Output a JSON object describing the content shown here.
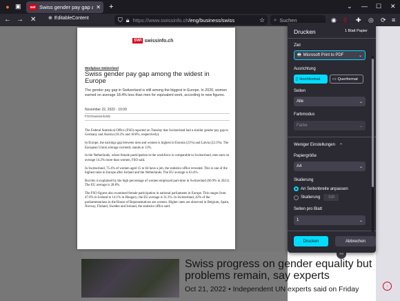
{
  "browser": {
    "tab_title": "Swiss gender pay gap among t",
    "favicon_text": "swi",
    "url_host": "https://www.swissinfo.ch",
    "url_path": "/eng/business/swiss",
    "search_placeholder": "Suchen",
    "editable_label": "EditableContent"
  },
  "preview": {
    "logo_mark": "SWI",
    "logo_site": "swissinfo.ch",
    "kicker": "Workplace Switzerland",
    "title": "Swiss gender pay gap among the widest in Europe",
    "lead": "The gender pay gap in Switzerland is still among the biggest in Europe. In 2020, women earned on average 18.4% less than men for equivalent work, according to new figures.",
    "date": "November 22, 2022 - 10:09",
    "credit": "FSO/swissinfo/sb",
    "paragraphs": [
      "The Federal Statistical Office (FSO) reported on Tuesday that Switzerland had a similar gender pay gap to Germany and Austria (18.3% and 18.8%, respectively).",
      "In Europe, the earnings gap between men and women is highest in Estonia (21%) and Latvia (22.3%). The European Union average currently stands at 13%.",
      "In the Netherlands, where female participation in the workforce is comparable to Switzerland, men earn on average 14.2% more than women, FSO said.",
      "In Switzerland, 75.4% of women aged 15 to 64 have a job, the statistics office revealed. This is one of the highest rates in Europe after Iceland and the Netherlands. The EU average is 63.4%.",
      "But this is explained by the high percentage of women employed part-time in Switzerland (60.9% in 2021). The EU average is 28.8%.",
      "The FSO figures also examined female participation in national parliaments in Europe. This ranges from 47.6% in Iceland to 14.1% in Hungary; the EU average is 31.3%. In Switzerland, 42% of the parliamentarians in the House of Representatives are women. Higher rates are observed in Belgium, Spain, Norway, Finland, Sweden and Iceland, the statistics office said."
    ]
  },
  "print": {
    "title": "Drucken",
    "sheets": "1 Blatt Papier",
    "dest_label": "Ziel",
    "dest_value": "Microsoft Print to PDF",
    "orient_label": "Ausrichtung",
    "portrait": "Hochformat",
    "landscape": "Querformat",
    "pages_label": "Seiten",
    "pages_value": "Alle",
    "color_label": "Farbmodus",
    "color_value": "Farbe",
    "more_settings": "Weniger Einstellungen",
    "paper_label": "Papiergröße",
    "paper_value": "A4",
    "scaling_label": "Skalierung",
    "fit_width": "An Seitenbreite anpassen",
    "scaling": "Skalierung",
    "scale_value": "100",
    "pps_label": "Seiten pro Blatt",
    "pps_value": "1",
    "print_btn": "Drucken",
    "cancel_btn": "Abbrechen"
  },
  "background": {
    "headline": "Swiss progress on gender equality but problems remain, say experts",
    "subline": "Oct 21, 2022 • Independent UN experts said on Friday"
  }
}
